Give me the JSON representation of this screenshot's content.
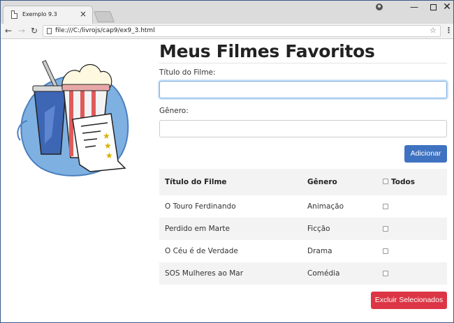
{
  "browser": {
    "tab_title": "Exemplo 9.3",
    "tab_close": "×",
    "url": "file:///C:/livrojs/cap9/ex9_3.html",
    "controls": {
      "minimize": "—",
      "close": "✕"
    }
  },
  "page": {
    "title": "Meus Filmes Favoritos",
    "form": {
      "title_label": "Título do Filme:",
      "title_value": "",
      "genre_label": "Gênero:",
      "genre_value": "",
      "add_button": "Adicionar"
    },
    "table": {
      "headers": [
        "Título do Filme",
        "Gênero",
        "Todos"
      ],
      "rows": [
        {
          "title": "O Touro Ferdinando",
          "genre": "Animação",
          "checked": false
        },
        {
          "title": "Perdido em Marte",
          "genre": "Ficção",
          "checked": false
        },
        {
          "title": "O Céu é de Verdade",
          "genre": "Drama",
          "checked": false
        },
        {
          "title": "SOS Mulheres ao Mar",
          "genre": "Comédia",
          "checked": false
        }
      ]
    },
    "delete_button": "Excluir Selecionados"
  },
  "colors": {
    "primary": "#3f73c1",
    "danger": "#dc3545",
    "row_stripe": "#f3f3f3"
  }
}
